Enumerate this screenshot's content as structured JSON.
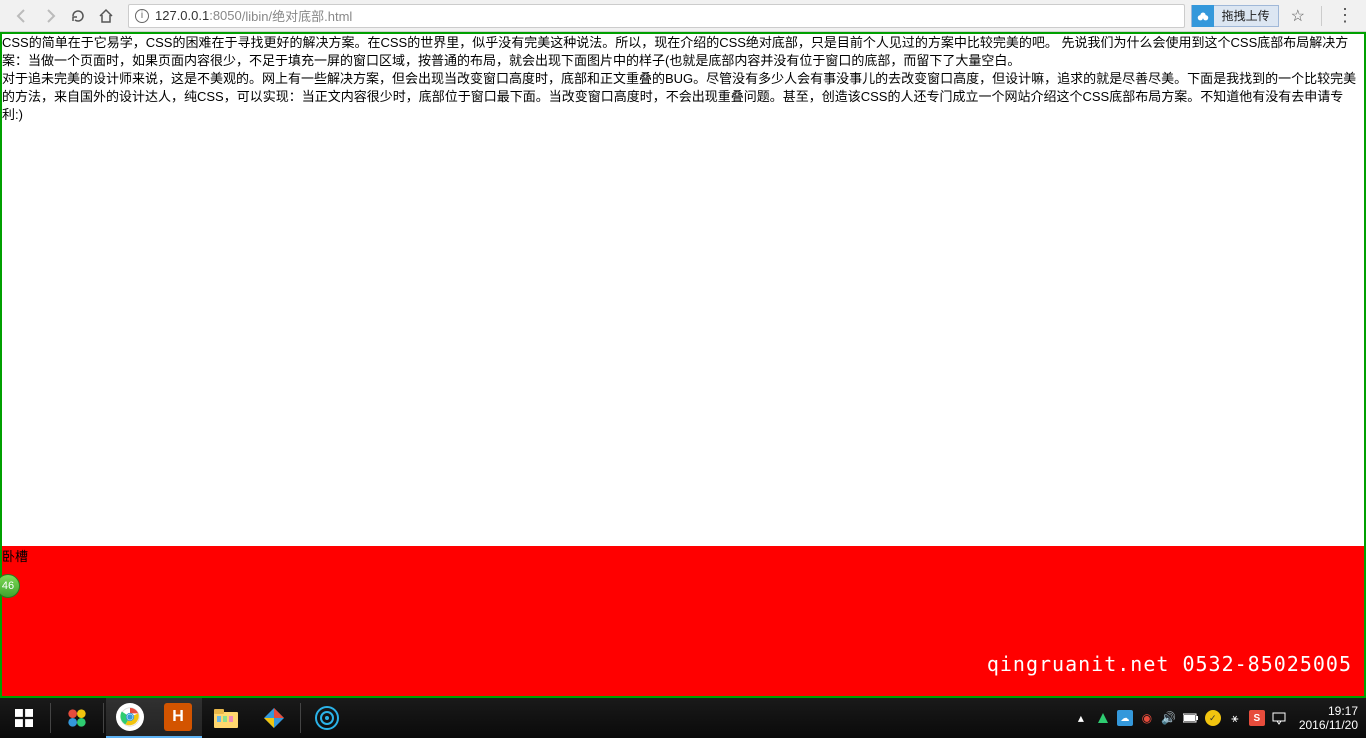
{
  "browser": {
    "url_host": "127.0.0.1",
    "url_port": ":8050",
    "url_path": "/libin/绝对底部.html",
    "baidu_label": "拖拽上传"
  },
  "content": {
    "p1": "CSS的简单在于它易学，CSS的困难在于寻找更好的解决方案。在CSS的世界里，似乎没有完美这种说法。所以，现在介绍的CSS绝对底部，只是目前个人见过的方案中比较完美的吧。 先说我们为什么会使用到这个CSS底部布局解决方案：当做一个页面时，如果页面内容很少，不足于填充一屏的窗口区域，按普通的布局，就会出现下面图片中的样子(也就是底部内容并没有位于窗口的底部，而留下了大量空白。",
    "p2": "对于追未完美的设计师来说，这是不美观的。网上有一些解决方案，但会出现当改变窗口高度时，底部和正文重叠的BUG。尽管没有多少人会有事没事儿的去改变窗口高度，但设计嘛，追求的就是尽善尽美。下面是我找到的一个比较完美的方法，来自国外的设计达人，纯CSS，可以实现：当正文内容很少时，底部位于窗口最下面。当改变窗口高度时，不会出现重叠问题。甚至，创造该CSS的人还专门成立一个网站介绍这个CSS底部布局方案。不知道他有没有去申请专利:)"
  },
  "footer": {
    "label": "卧槽",
    "badge": "46",
    "contact": "qingruanit.net 0532-85025005"
  },
  "taskbar": {
    "time": "19:17",
    "date": "2016/11/20"
  }
}
